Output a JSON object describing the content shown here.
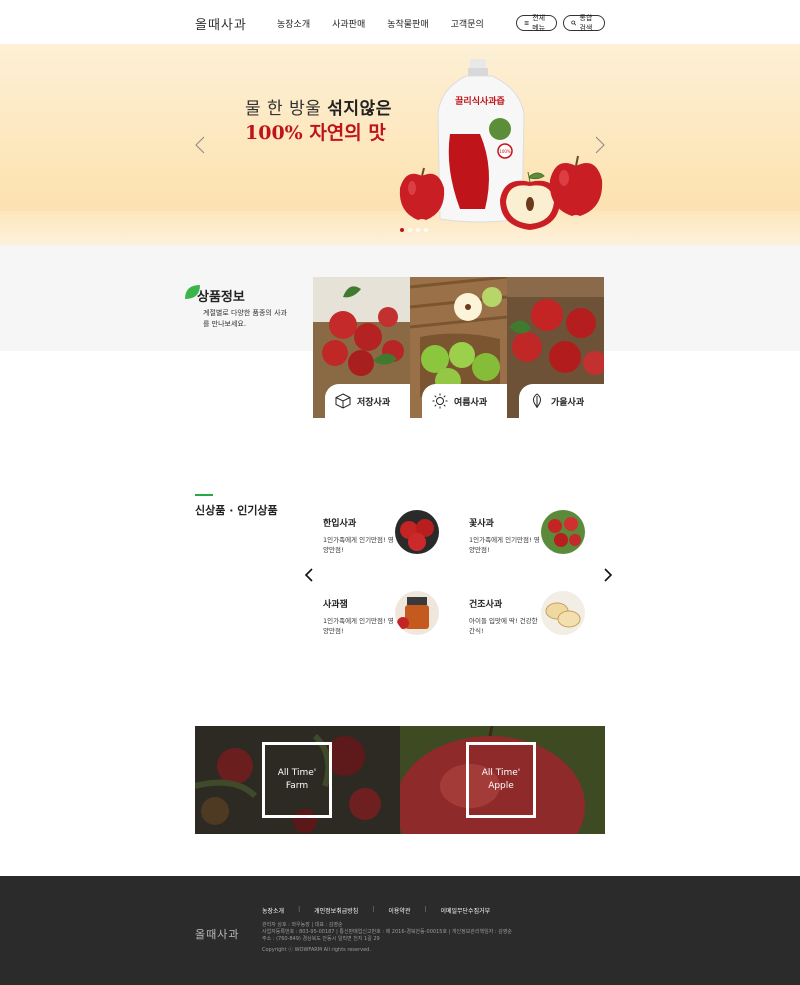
{
  "header": {
    "logo": "올때사과",
    "nav": [
      "농장소개",
      "사과판매",
      "농작물판매",
      "고객문의"
    ],
    "all_menu_label": "전체메뉴",
    "search_label": "통합검색"
  },
  "hero": {
    "line1_prefix": "물 한 방울 ",
    "line1_bold": "섞지않은",
    "line2": "100% 자연의 맛",
    "pouch_label": "끌리식사과즙",
    "pouch_sub": "100%",
    "slide_count": 4,
    "active_slide": 1
  },
  "product_info": {
    "title": "상품정보",
    "desc": "계절별로 다양한 품종의 사과를 만나보세요.",
    "cards": [
      {
        "label": "저장사과",
        "icon": "box-icon"
      },
      {
        "label": "여름사과",
        "icon": "sun-icon"
      },
      {
        "label": "가을사과",
        "icon": "leaf-icon"
      }
    ]
  },
  "new_products": {
    "title": "신상품 · 인기상품",
    "items": [
      {
        "name": "한입사과",
        "desc": "1인가족에게 인기만점! 영양만점!"
      },
      {
        "name": "꽃사과",
        "desc": "1인가족에게 인기만점! 영양만점!"
      },
      {
        "name": "사과잼",
        "desc": "1인가족에게 인기만점! 영양만점!"
      },
      {
        "name": "건조사과",
        "desc": "아이들 입맛에 딱! 건강한 간식!"
      }
    ]
  },
  "banners": [
    {
      "line1": "All Time'",
      "line2": "Farm"
    },
    {
      "line1": "All Time'",
      "line2": "Apple"
    }
  ],
  "footer": {
    "logo": "올때사과",
    "links": [
      "농장소개",
      "개인정보취급방침",
      "이용약관",
      "이메일무단수집거부"
    ],
    "info1": "관리자 상호 : 와우농장 | 대표 : 김영순",
    "info2": "사업자등록번호 : 803-95-00187 | 통신판매업신고번호 : 제 2016-경북안동-00015호 | 개인정보관리책임자 : 김영순",
    "info3": "주소 : (760-849) 경상북도 안동시 일직면 천지 1길 29",
    "copyright": "Copyright ⓒ WOWFARM All rights reserved."
  },
  "colors": {
    "accent_red": "#c0141b",
    "accent_green": "#27a844",
    "footer_bg": "#2b2b2b"
  }
}
